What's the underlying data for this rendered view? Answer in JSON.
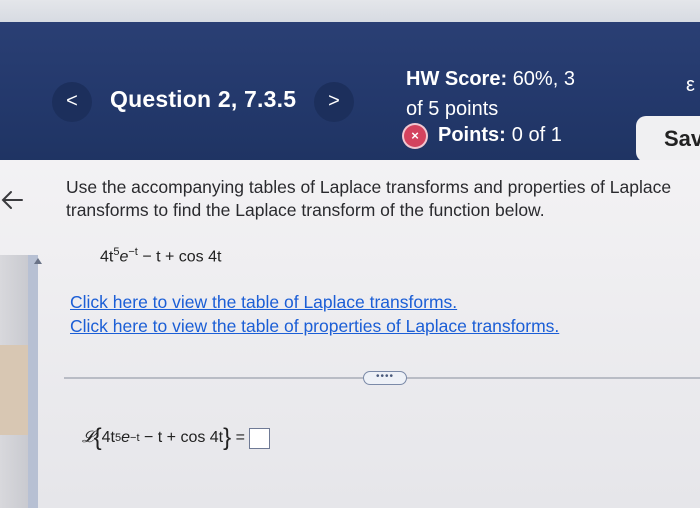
{
  "header": {
    "prev_label": "<",
    "question_title": "Question 2, 7.3.5",
    "next_label": ">",
    "hw_score_label": "HW Score:",
    "hw_score_value": "60%, 3",
    "hw_score_line2": "of 5 points",
    "points_label": "Points:",
    "points_value": "0 of 1",
    "points_badge": "×",
    "settings_glyph": "ε",
    "save_label": "Sav"
  },
  "problem": {
    "prompt_line1": "Use the accompanying tables of Laplace transforms and properties of Laplace",
    "prompt_line2": "transforms to find the Laplace transform of the function below.",
    "expr_coef": "4t",
    "expr_pow": "5",
    "expr_e": "e",
    "expr_eexp": "−t",
    "expr_rest": "− t + cos 4t",
    "link_table": "Click here to view the table of Laplace transforms.",
    "link_properties": "Click here to view the table of properties of Laplace transforms.",
    "more_label": "••••",
    "answer_script_L": "𝓛",
    "answer_open": "{",
    "answer_close": "}",
    "answer_equals": "="
  },
  "colors": {
    "header_bg": "#23386b",
    "link": "#1b5ed6",
    "badge_red": "#d3425e"
  }
}
